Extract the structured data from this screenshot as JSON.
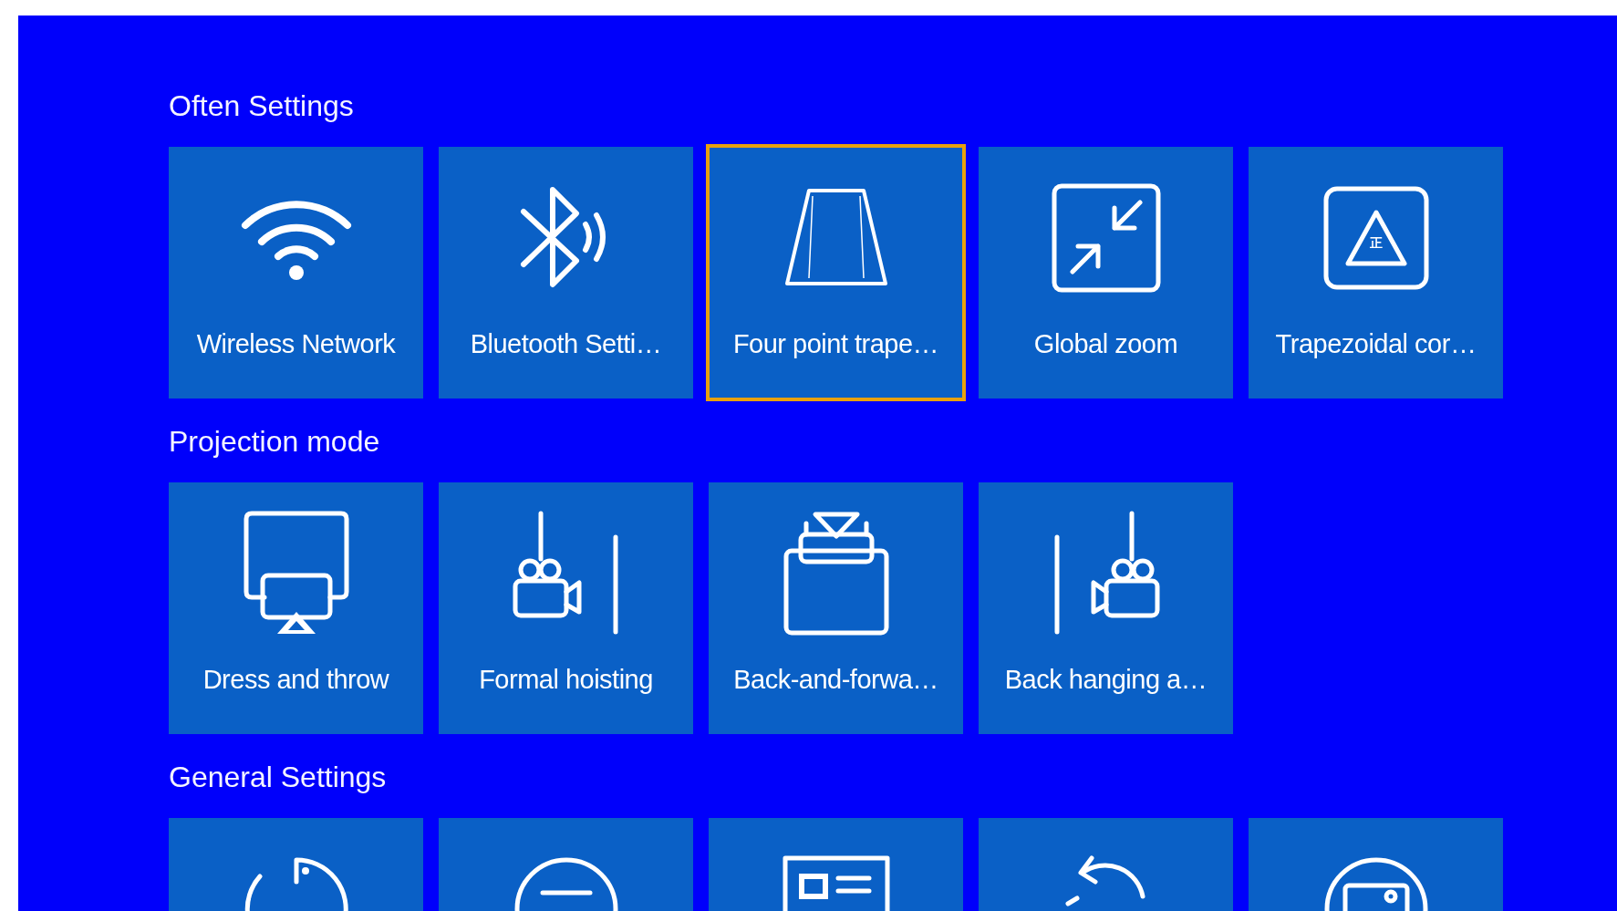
{
  "sections": [
    {
      "title": "Often Settings",
      "tiles": [
        {
          "label": "Wireless Network",
          "selected": false
        },
        {
          "label": "Bluetooth Setti…",
          "selected": false
        },
        {
          "label": "Four point trape…",
          "selected": true
        },
        {
          "label": "Global zoom",
          "selected": false
        },
        {
          "label": "Trapezoidal cor…",
          "icon_text": "正",
          "selected": false
        }
      ]
    },
    {
      "title": "Projection mode",
      "tiles": [
        {
          "label": "Dress and throw",
          "selected": false
        },
        {
          "label": "Formal hoisting",
          "selected": false
        },
        {
          "label": "Back-and-forwa…",
          "selected": false
        },
        {
          "label": "Back hanging a…",
          "selected": false
        }
      ]
    },
    {
      "title": "General Settings",
      "tiles": [
        {
          "selected": false
        },
        {
          "selected": false
        },
        {
          "selected": false
        },
        {
          "selected": false
        },
        {
          "selected": false
        }
      ]
    }
  ]
}
